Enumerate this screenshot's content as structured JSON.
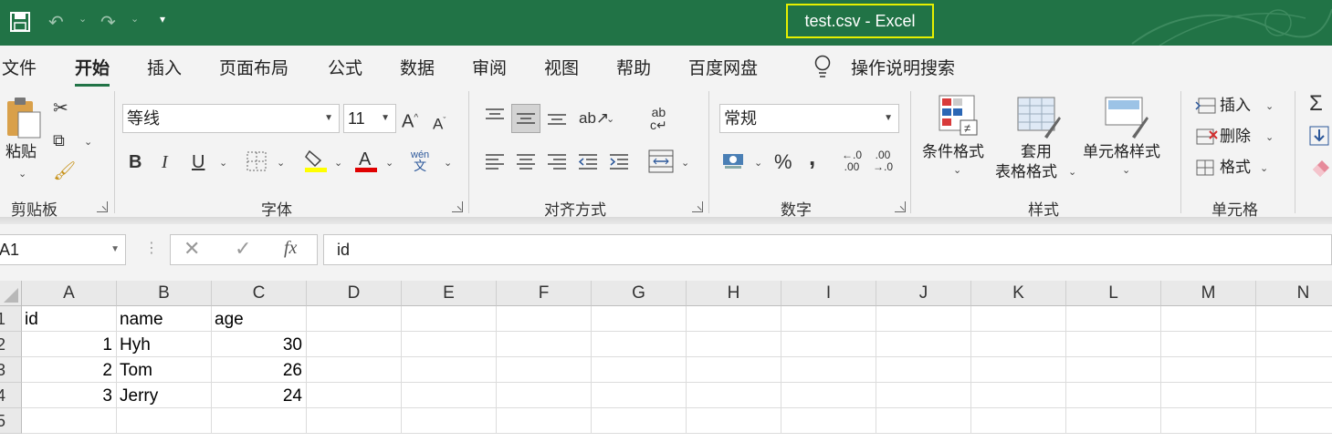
{
  "title_bar": {
    "title": "test.csv  -  Excel"
  },
  "tabs": [
    "文件",
    "开始",
    "插入",
    "页面布局",
    "公式",
    "数据",
    "审阅",
    "视图",
    "帮助",
    "百度网盘"
  ],
  "active_tab": "开始",
  "search": {
    "label": "操作说明搜索"
  },
  "clipboard": {
    "paste_label": "粘贴",
    "group_label": "剪贴板"
  },
  "font": {
    "name": "等线",
    "size": "11",
    "group_label": "字体",
    "bold": "B",
    "italic": "I",
    "underline": "U",
    "phonetic": "wén 文"
  },
  "alignment": {
    "group_label": "对齐方式"
  },
  "number": {
    "format": "常规",
    "group_label": "数字",
    "percent": "%",
    "comma": ",",
    "inc_decimal": "←.0\n.00",
    "dec_decimal": ".00\n→.0"
  },
  "styles": {
    "conditional": "条件格式",
    "table_format_1": "套用",
    "table_format_2": "表格格式",
    "cell_styles": "单元格样式",
    "group_label": "样式"
  },
  "cells": {
    "insert": "插入",
    "delete": "删除",
    "format": "格式",
    "group_label": "单元格"
  },
  "formula_bar": {
    "name_box": "A1",
    "fx": "fx",
    "value": "id"
  },
  "columns": [
    "A",
    "B",
    "C",
    "D",
    "E",
    "F",
    "G",
    "H",
    "I",
    "J",
    "K",
    "L",
    "M",
    "N"
  ],
  "rows": [
    "1",
    "2",
    "3",
    "4",
    "5"
  ],
  "sheet": [
    [
      "id",
      "name",
      "age"
    ],
    [
      "1",
      "Hyh",
      "30"
    ],
    [
      "2",
      "Tom",
      "26"
    ],
    [
      "3",
      "Jerry",
      "24"
    ]
  ],
  "colors": {
    "excel_green": "#217346",
    "highlight_outline": "#e6f000",
    "font_yellow": "#ffff00",
    "font_red": "#e00000"
  }
}
